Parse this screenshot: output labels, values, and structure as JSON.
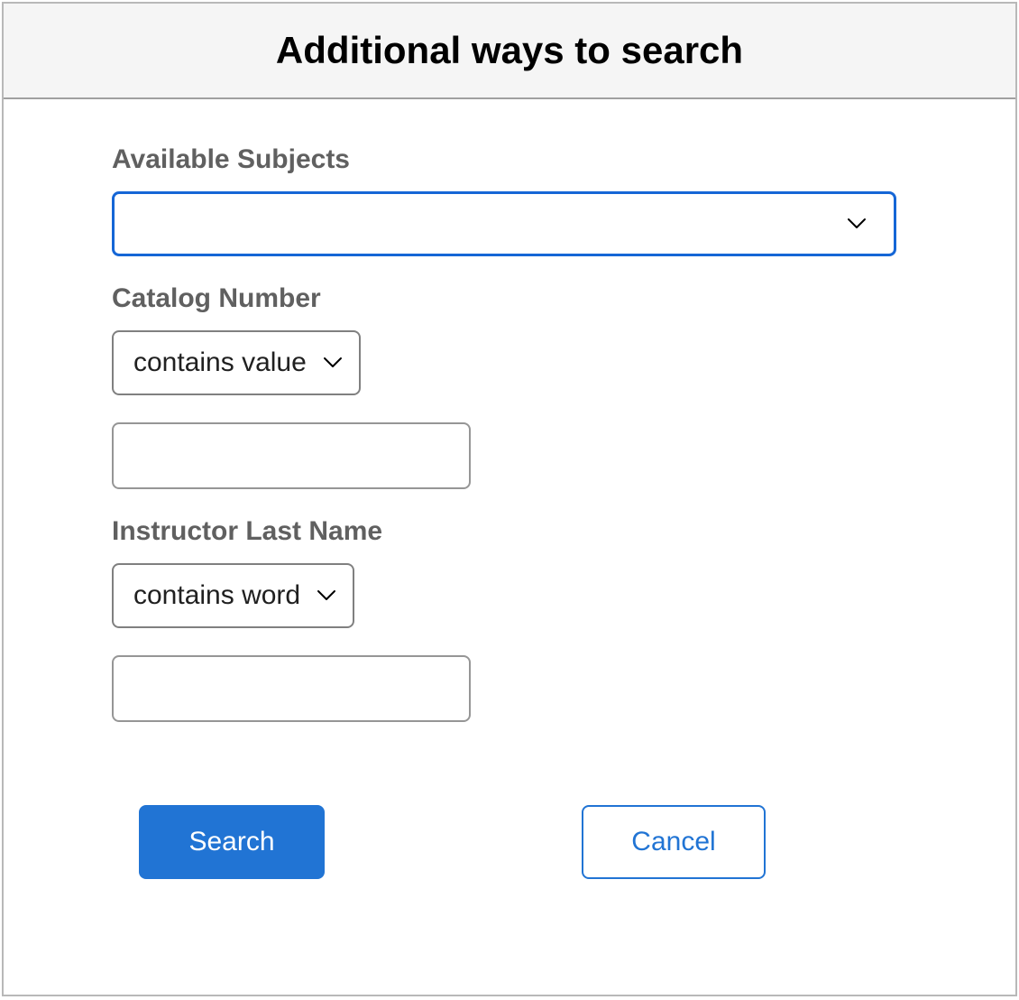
{
  "header": {
    "title": "Additional ways to search"
  },
  "form": {
    "subjects": {
      "label": "Available Subjects",
      "selected": ""
    },
    "catalog": {
      "label": "Catalog Number",
      "operator": "contains value",
      "value": ""
    },
    "instructor": {
      "label": "Instructor Last Name",
      "operator": "contains word",
      "value": ""
    }
  },
  "buttons": {
    "search": "Search",
    "cancel": "Cancel"
  }
}
